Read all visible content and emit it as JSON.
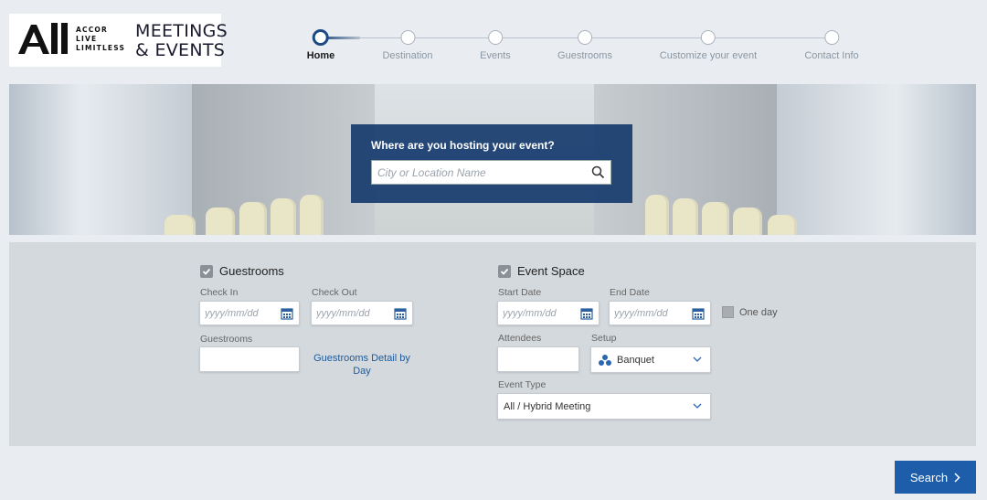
{
  "logo": {
    "mark": "All",
    "small_lines": [
      "ACCOR",
      "LIVE",
      "LIMITLESS"
    ],
    "title_lines": [
      "MEETINGS",
      "& EVENTS"
    ]
  },
  "stepper": {
    "steps": [
      {
        "label": "Home",
        "active": true
      },
      {
        "label": "Destination",
        "active": false
      },
      {
        "label": "Events",
        "active": false
      },
      {
        "label": "Guestrooms",
        "active": false
      },
      {
        "label": "Customize your event",
        "active": false
      },
      {
        "label": "Contact Info",
        "active": false
      }
    ]
  },
  "hero": {
    "question": "Where are you hosting your event?",
    "search_placeholder": "City or Location Name"
  },
  "guestrooms": {
    "label": "Guestrooms",
    "checked": true,
    "check_in_label": "Check In",
    "check_in_placeholder": "yyyy/mm/dd",
    "check_out_label": "Check Out",
    "check_out_placeholder": "yyyy/mm/dd",
    "count_label": "Guestrooms",
    "count_value": "",
    "detail_link": "Guestrooms Detail by Day"
  },
  "event_space": {
    "label": "Event Space",
    "checked": true,
    "start_label": "Start Date",
    "start_placeholder": "yyyy/mm/dd",
    "end_label": "End Date",
    "end_placeholder": "yyyy/mm/dd",
    "one_day_label": "One day",
    "attendees_label": "Attendees",
    "attendees_value": "",
    "setup_label": "Setup",
    "setup_value": "Banquet",
    "event_type_label": "Event Type",
    "event_type_value": "All / Hybrid Meeting"
  },
  "search_button": "Search",
  "colors": {
    "primary": "#1e5daa",
    "hero_panel": "#163b6e",
    "stepper_active": "#1e4a84"
  }
}
